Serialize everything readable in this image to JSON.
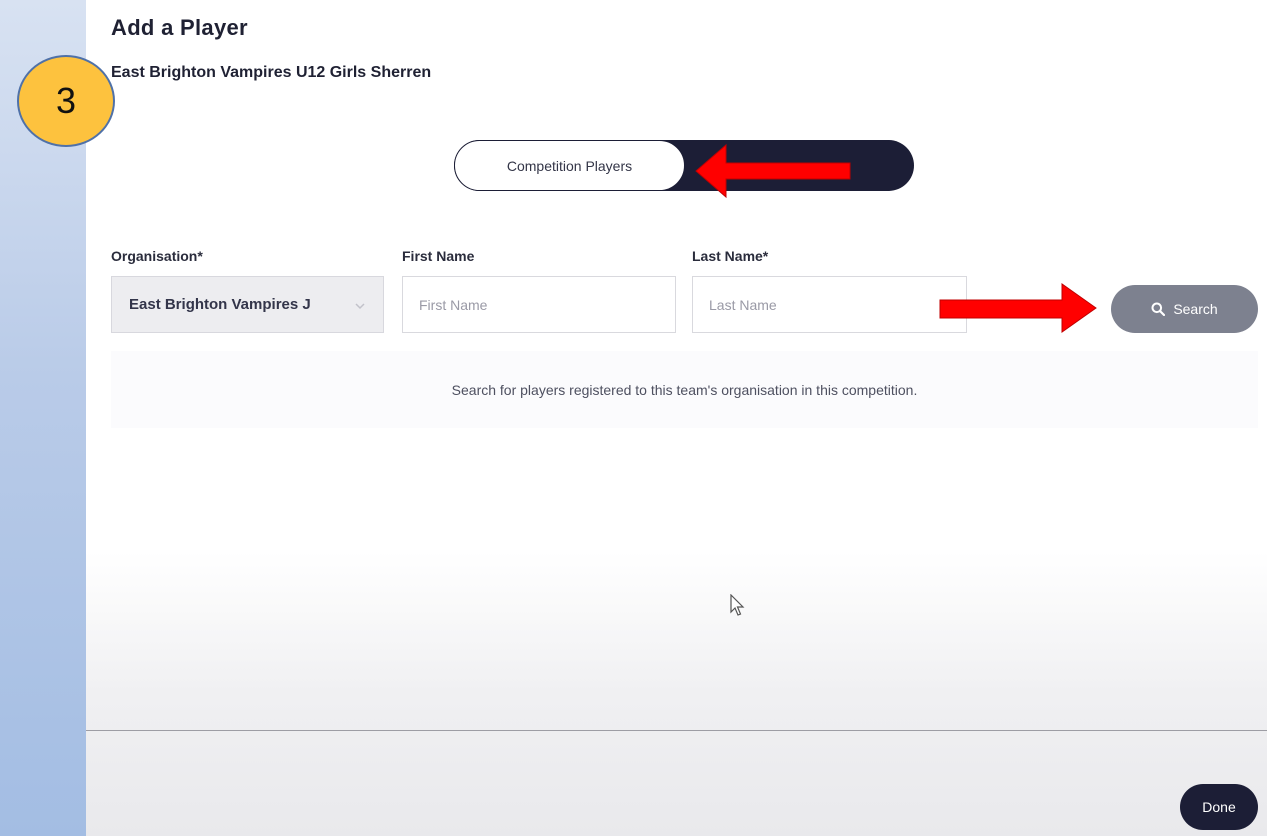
{
  "step": {
    "number": "3"
  },
  "dialog": {
    "title": "Add a Player",
    "team_name": "East Brighton Vampires U12 Girls Sherren"
  },
  "toggle": {
    "active_label": "Competition Players",
    "inactive_label": ""
  },
  "form": {
    "organisation_label": "Organisation*",
    "organisation_value": "East Brighton Vampires J",
    "first_name_label": "First Name",
    "first_name_placeholder": "First Name",
    "last_name_label": "Last Name*",
    "last_name_placeholder": "Last Name",
    "search_label": "Search"
  },
  "info": {
    "message": "Search for players registered to this team's organisation in this competition."
  },
  "footer": {
    "done_label": "Done"
  },
  "colors": {
    "annotation_arrow": "#ff0000",
    "badge_fill": "#fdc23e",
    "badge_border": "#4f71a8",
    "dark_navy": "#1c1e36",
    "search_button": "#7d818f"
  }
}
